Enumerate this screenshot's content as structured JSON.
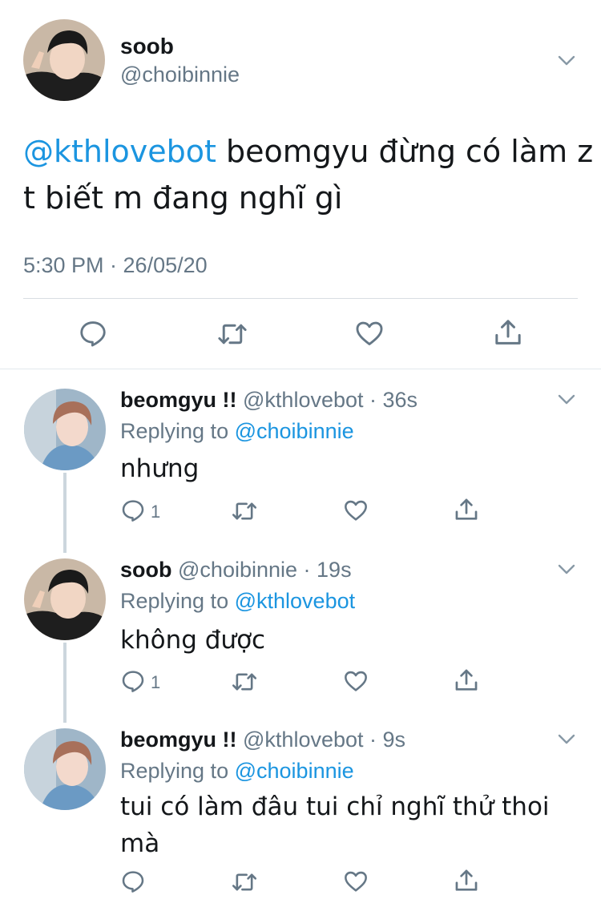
{
  "main_tweet": {
    "display_name": "soob",
    "handle": "@choibinnie",
    "mention": "@kthlovebot",
    "text_line1": " beomgyu đừng có làm z",
    "text_line2": "t biết m đang nghĩ gì",
    "timestamp": "5:30 PM · 26/05/20"
  },
  "replies": [
    {
      "display_name": "beomgyu !!",
      "handle": "@kthlovebot",
      "time": "· 36s",
      "replying_label": "Replying to",
      "replying_to": "@choibinnie",
      "text_line1": "nhưng",
      "text_line2": "",
      "reply_count": "1"
    },
    {
      "display_name": "soob",
      "handle": "@choibinnie",
      "time": "· 19s",
      "replying_label": "Replying to",
      "replying_to": "@kthlovebot",
      "text_line1": "không được",
      "text_line2": "",
      "reply_count": "1"
    },
    {
      "display_name": "beomgyu !!",
      "handle": "@kthlovebot",
      "time": "· 9s",
      "replying_label": "Replying to",
      "replying_to": "@choibinnie",
      "text_line1": "tui có làm đâu tui chỉ nghĩ thử thoi",
      "text_line2": "mà",
      "reply_count": ""
    }
  ],
  "colors": {
    "link": "#1b95e0",
    "secondary_text": "#657786",
    "primary_text": "#14171a",
    "divider": "#d8dee3",
    "thread_line": "#ccd6dd"
  },
  "icons": [
    "reply-icon",
    "retweet-icon",
    "like-icon",
    "share-icon",
    "chevron-down-icon"
  ]
}
